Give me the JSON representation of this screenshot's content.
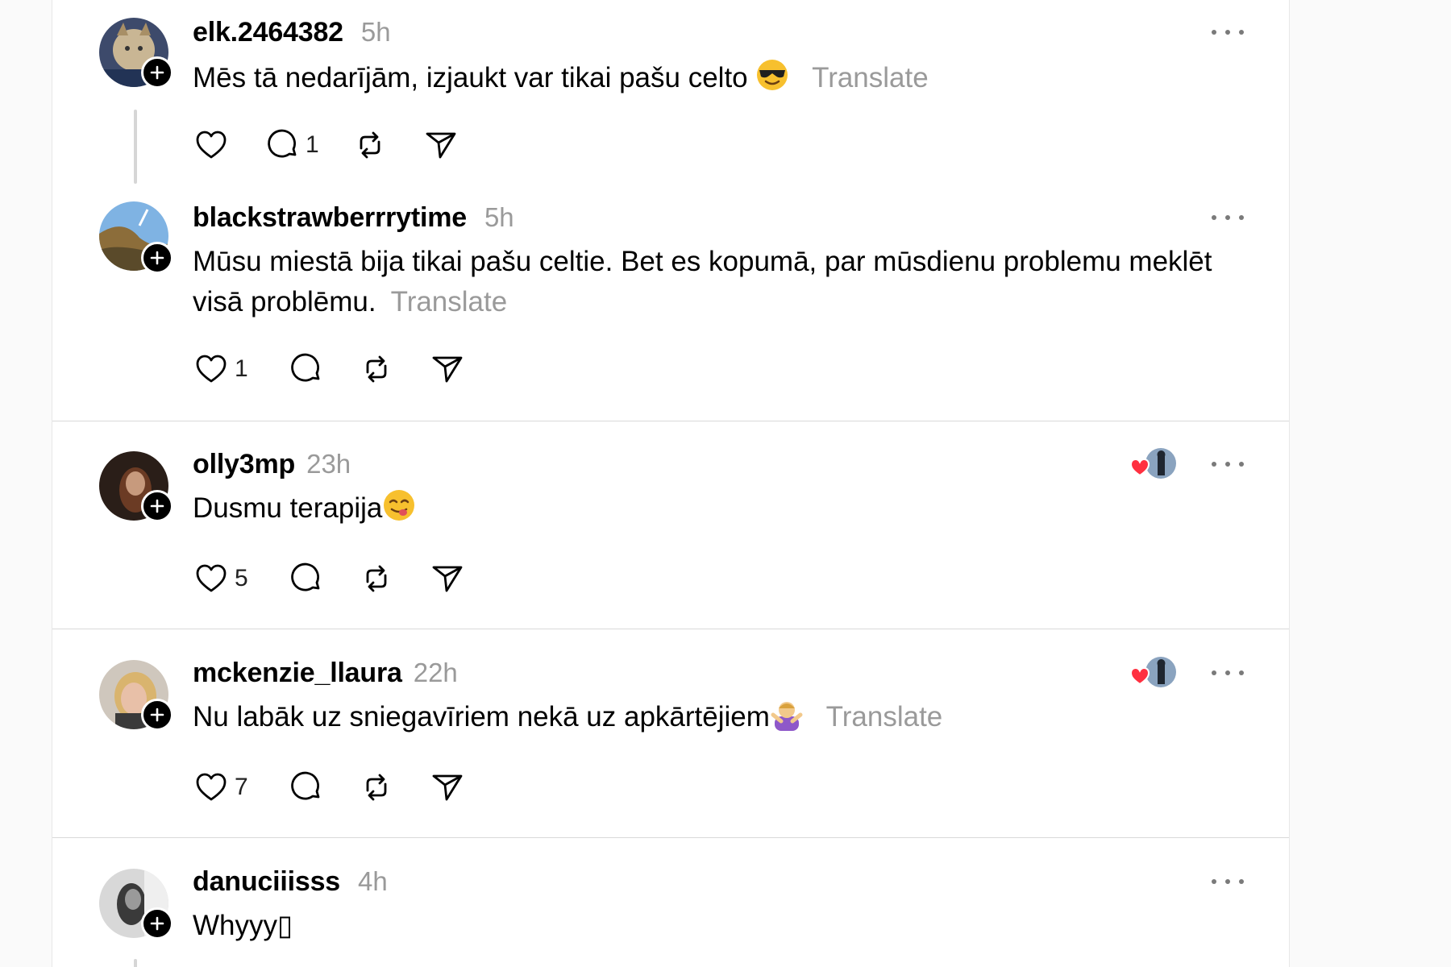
{
  "posts": [
    {
      "username": "elk.2464382",
      "time": "5h",
      "text": "Mēs tā nedarījām, izjaukt var tikai pašu celto",
      "translate": "Translate",
      "reply_count": "1",
      "emoji": "sunglasses-emoji"
    },
    {
      "username": "blackstrawberrrytime",
      "time": "5h",
      "text_line1": "Mūsu miestā bija tikai pašu celtie. Bet es kopumā, par mūsdienu problemu meklēt",
      "text_line2": "visā problēmu.",
      "translate": "Translate",
      "like_count": "1"
    },
    {
      "username": "olly3mp",
      "time": "23h",
      "text": "Dusmu terapija",
      "like_count": "5",
      "emoji": "yum-face-emoji"
    },
    {
      "username": "mckenzie_llaura",
      "time": "22h",
      "text": "Nu labāk uz sniegavīriem nekā uz apkārtējiem",
      "translate": "Translate",
      "like_count": "7",
      "emoji": "person-gesturing-no-emoji"
    },
    {
      "username": "danuciiisss",
      "time": "4h",
      "text": "Whyyy▯"
    }
  ],
  "icons": {
    "like": "heart-icon",
    "reply": "comment-icon",
    "repost": "repost-icon",
    "share": "send-icon",
    "more": "more-dots-icon",
    "follow": "plus-icon"
  },
  "colors": {
    "background": "#ffffff",
    "muted_text": "#9a9a9a",
    "liked_heart": "#ff3040"
  }
}
